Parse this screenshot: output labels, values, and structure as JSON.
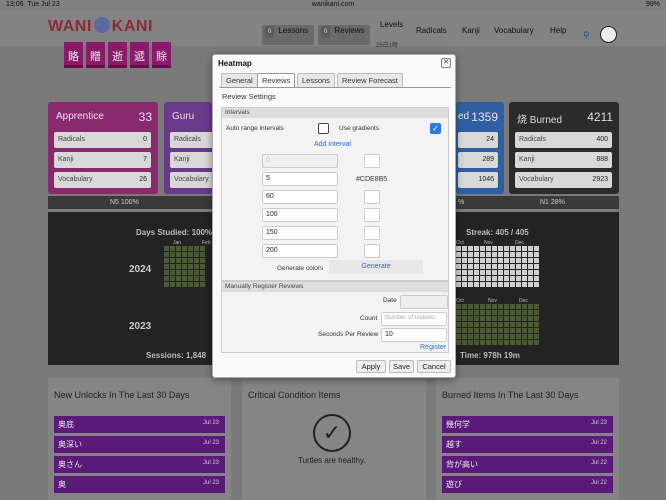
{
  "status": {
    "time": "13:06",
    "date": "Tue Jul 23",
    "url": "wanikani.com",
    "battery": "99%"
  },
  "nav": {
    "logo_left": "WANI",
    "logo_right": "KANI",
    "lessons_count": "0",
    "lessons_label": "Lessons",
    "reviews_count": "0",
    "reviews_label": "Reviews",
    "levels_label": "Levels",
    "levels_sub": "25日1時",
    "radicals_label": "Radicals",
    "kanji_label": "Kanji",
    "vocab_label": "Vocabulary",
    "help_label": "Help"
  },
  "kanji_tiles": [
    "賂",
    "贈",
    "逝",
    "遞",
    "賖"
  ],
  "srs": {
    "apprentice": {
      "label": "Apprentice",
      "count": "33",
      "radicals": "0",
      "kanji": "7",
      "vocab": "26"
    },
    "guru": {
      "label": "Guru",
      "radicals_label": "Radicals",
      "kanji_label": "Kanji",
      "vocab_label": "Vocabulary"
    },
    "enlightened": {
      "label": "ed",
      "count": "1359",
      "radicals": "24",
      "kanji": "289",
      "vocab": "1046"
    },
    "burned": {
      "label": "Burned",
      "count": "4211",
      "radicals": "400",
      "kanji": "888",
      "vocab": "2923"
    },
    "row_labels": {
      "radicals": "Radicals",
      "kanji": "Kanji",
      "vocab": "Vocabulary"
    }
  },
  "jlpt": {
    "n5": "N5 100%",
    "n1": "N1 28%",
    "mid": "%"
  },
  "heatmap": {
    "days_studied": "Days Studied: 100%",
    "streak": "Streak: 405 / 405",
    "year1": "2024",
    "year2": "2023",
    "sessions": "Sessions: 1,848",
    "time": "Time: 978h 19m",
    "months_2024_left": [
      "Jan",
      "Feb"
    ],
    "months_2024_right": [
      "Oct",
      "Nov",
      "Dec"
    ],
    "months_2023_right": [
      "Oct",
      "Nov",
      "Dec"
    ],
    "weekdays": "M T W T F S S"
  },
  "bottom": {
    "unlocks_title": "New Unlocks In The Last 30 Days",
    "unlocks": [
      {
        "word": "奥底",
        "date": "Jul 23"
      },
      {
        "word": "奥深い",
        "date": "Jul 23"
      },
      {
        "word": "奥さん",
        "date": "Jul 23"
      },
      {
        "word": "奥",
        "date": "Jul 23"
      }
    ],
    "critical_title": "Critical Condition Items",
    "critical_msg": "Turtles are healthy.",
    "burned_title": "Burned Items In The Last 30 Days",
    "burned": [
      {
        "word": "幾何学",
        "date": "Jul 23"
      },
      {
        "word": "越す",
        "date": "Jul 22"
      },
      {
        "word": "背が高い",
        "date": "Jul 22"
      },
      {
        "word": "遊び",
        "date": "Jul 22"
      }
    ]
  },
  "modal": {
    "title": "Heatmap",
    "tabs": [
      "General",
      "Reviews",
      "Lessons",
      "Review Forecast"
    ],
    "active_tab": "Reviews",
    "section": "Review Settings",
    "intervals_head": "Intervals",
    "auto_range_label": "Auto range intervals",
    "use_gradients_label": "Use gradients",
    "auto_range": false,
    "use_gradients": true,
    "add_interval": "Add interval",
    "intervals": [
      "0",
      "5",
      "60",
      "100",
      "150",
      "200"
    ],
    "gradient_color": "#CDE8B5",
    "generate_colors_label": "Generate colors",
    "generate_btn": "Generate",
    "manual_head": "Manually Register Reviews",
    "date_label": "Date",
    "count_label": "Count",
    "count_placeholder": "Number of reviews",
    "spr_label": "Seconds Per Review",
    "spr_value": "10",
    "register": "Register",
    "apply": "Apply",
    "save": "Save",
    "cancel": "Cancel"
  }
}
